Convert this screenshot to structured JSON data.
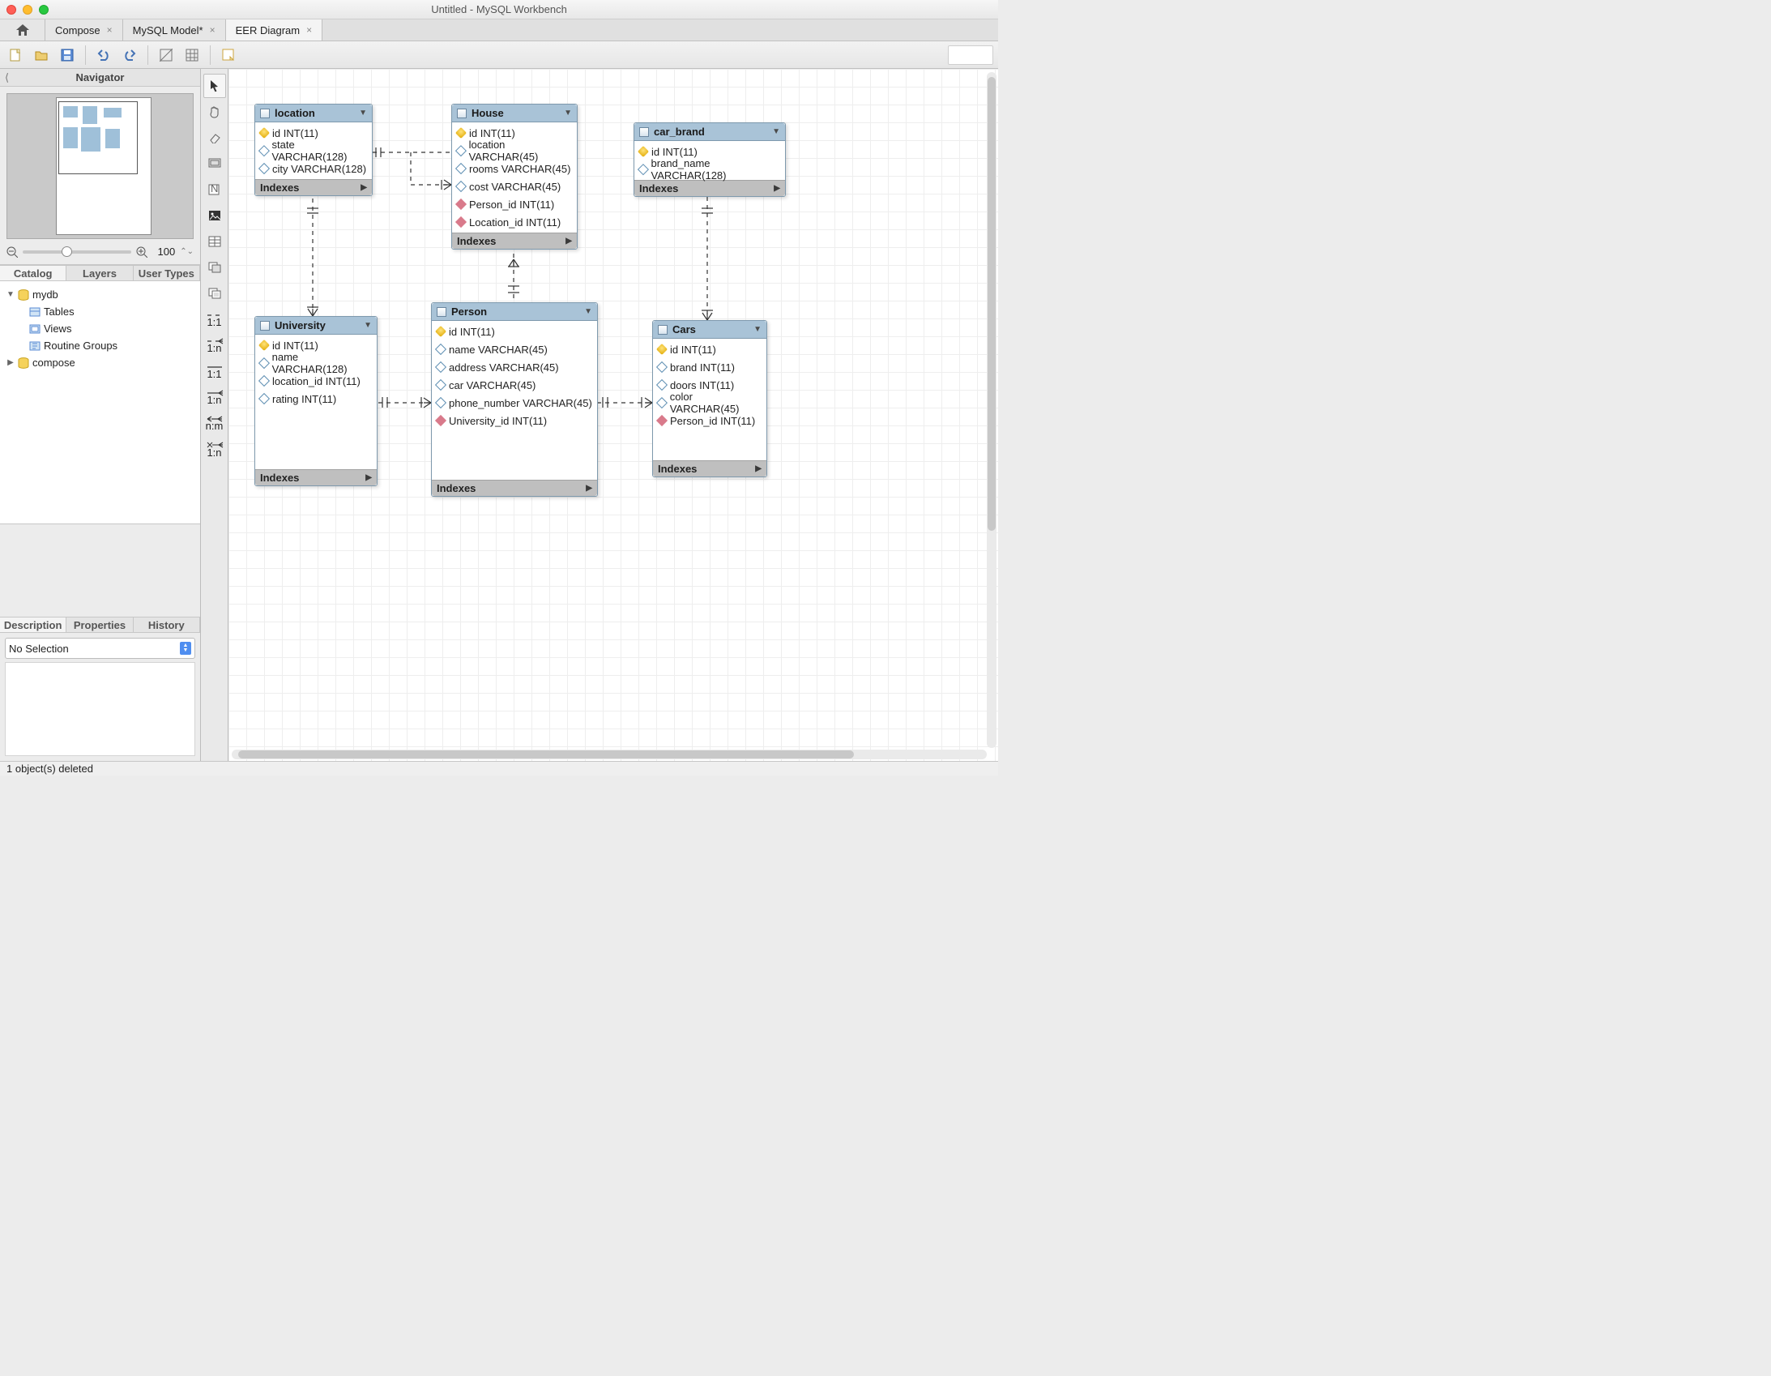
{
  "window": {
    "title": "Untitled - MySQL Workbench"
  },
  "tabs": [
    {
      "label": "Compose",
      "closable": true,
      "active": false
    },
    {
      "label": "MySQL Model*",
      "closable": true,
      "active": false
    },
    {
      "label": "EER Diagram",
      "closable": true,
      "active": true
    }
  ],
  "sidebar": {
    "navigator_label": "Navigator",
    "zoom_value": "100",
    "catalog_tabs": [
      "Catalog",
      "Layers",
      "User Types"
    ],
    "catalog_active": 0,
    "tree": {
      "db1": {
        "name": "mydb",
        "expanded": true,
        "children": [
          "Tables",
          "Views",
          "Routine Groups"
        ]
      },
      "db2": {
        "name": "compose",
        "expanded": false
      }
    },
    "bottom_tabs": [
      "Description",
      "Properties",
      "History"
    ],
    "bottom_active": 0,
    "selection_text": "No Selection"
  },
  "status": {
    "text": "1 object(s) deleted"
  },
  "entities": {
    "location": {
      "title": "location",
      "cols": [
        {
          "icon": "pk",
          "text": "id INT(11)"
        },
        {
          "icon": "reg",
          "text": "state VARCHAR(128)"
        },
        {
          "icon": "reg",
          "text": "city VARCHAR(128)"
        }
      ],
      "indexes": "Indexes"
    },
    "house": {
      "title": "House",
      "cols": [
        {
          "icon": "pk",
          "text": "id INT(11)"
        },
        {
          "icon": "reg",
          "text": "location VARCHAR(45)"
        },
        {
          "icon": "reg",
          "text": "rooms VARCHAR(45)"
        },
        {
          "icon": "reg",
          "text": "cost VARCHAR(45)"
        },
        {
          "icon": "fk",
          "text": "Person_id INT(11)"
        },
        {
          "icon": "fk",
          "text": "Location_id INT(11)"
        }
      ],
      "indexes": "Indexes"
    },
    "car_brand": {
      "title": "car_brand",
      "cols": [
        {
          "icon": "pk",
          "text": "id INT(11)"
        },
        {
          "icon": "reg",
          "text": "brand_name VARCHAR(128)"
        }
      ],
      "indexes": "Indexes"
    },
    "university": {
      "title": "University",
      "cols": [
        {
          "icon": "pk",
          "text": "id INT(11)"
        },
        {
          "icon": "reg",
          "text": "name VARCHAR(128)"
        },
        {
          "icon": "reg",
          "text": "location_id INT(11)"
        },
        {
          "icon": "reg",
          "text": "rating INT(11)"
        }
      ],
      "indexes": "Indexes"
    },
    "person": {
      "title": "Person",
      "cols": [
        {
          "icon": "pk",
          "text": "id INT(11)"
        },
        {
          "icon": "reg",
          "text": "name VARCHAR(45)"
        },
        {
          "icon": "reg",
          "text": "address VARCHAR(45)"
        },
        {
          "icon": "reg",
          "text": "car VARCHAR(45)"
        },
        {
          "icon": "reg",
          "text": "phone_number VARCHAR(45)"
        },
        {
          "icon": "fk",
          "text": "University_id INT(11)"
        }
      ],
      "indexes": "Indexes"
    },
    "cars": {
      "title": "Cars",
      "cols": [
        {
          "icon": "pk",
          "text": "id INT(11)"
        },
        {
          "icon": "reg",
          "text": "brand INT(11)"
        },
        {
          "icon": "reg",
          "text": "doors INT(11)"
        },
        {
          "icon": "reg",
          "text": "color VARCHAR(45)"
        },
        {
          "icon": "fk",
          "text": "Person_id INT(11)"
        }
      ],
      "indexes": "Indexes"
    }
  },
  "palette_rel": {
    "r11": "1:1",
    "r1n": "1:n",
    "r11b": "1:1",
    "rnm": "n:m",
    "r1nb": "1:n"
  }
}
